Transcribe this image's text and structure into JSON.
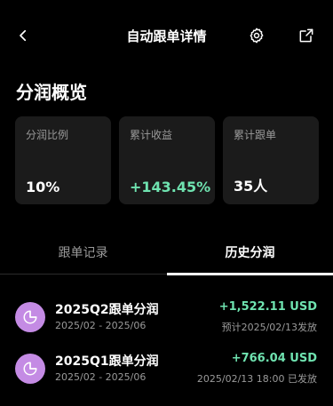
{
  "header": {
    "title": "自动跟单详情",
    "icons": [
      "back-icon",
      "gear-icon",
      "share-icon"
    ]
  },
  "overview": {
    "title": "分润概览",
    "cards": [
      {
        "label": "分润比例",
        "value": "10%"
      },
      {
        "label": "累计收益",
        "value": "+143.45%"
      },
      {
        "label": "累计跟单",
        "value": "35人"
      }
    ]
  },
  "tabs": [
    {
      "label": "跟单记录",
      "active": false
    },
    {
      "label": "历史分润",
      "active": true
    }
  ],
  "history": [
    {
      "title": "2025Q2跟单分润",
      "range": "2025/02 - 2025/06",
      "amount": "+1,522.11 USD",
      "note": "预计2025/02/13发放"
    },
    {
      "title": "2025Q1跟单分润",
      "range": "2025/02 - 2025/06",
      "amount": "+766.04 USD",
      "note": "2025/02/13 18:00 已发放"
    }
  ],
  "colors": {
    "background": "#000000",
    "card": "#1b1b1b",
    "positive": "#6fe3b0",
    "avatar": "#c48be4",
    "muted": "#9a9a9a"
  }
}
